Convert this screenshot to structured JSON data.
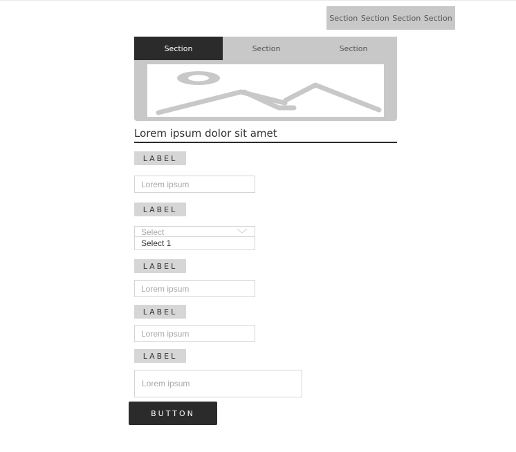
{
  "top_nav": {
    "items": [
      "Section",
      "Section",
      "Section",
      "Section"
    ]
  },
  "tabs": [
    {
      "label": "Section",
      "active": true
    },
    {
      "label": "Section",
      "active": false
    },
    {
      "label": "Section",
      "active": false
    }
  ],
  "image_placeholder": {
    "icon": "image-placeholder-icon"
  },
  "heading": "Lorem ipsum dolor sit amet",
  "form": {
    "field1": {
      "label": "LABEL",
      "placeholder": "Lorem ipsum"
    },
    "field2": {
      "label": "LABEL",
      "placeholder": "Select",
      "selected": "Select 1"
    },
    "field3": {
      "label": "LABEL",
      "placeholder": "Lorem ipsum"
    },
    "field4": {
      "label": "LABEL",
      "placeholder": "Lorem ipsum"
    },
    "field5": {
      "label": "LABEL",
      "placeholder": "Lorem ipsum"
    }
  },
  "button_label": "BUTTON",
  "colors": {
    "dark": "#2b2b2b",
    "gray": "#c8c8c8",
    "label_bg": "#d6d6d6",
    "border": "#d4d4d4",
    "placeholder": "#a8a8a8"
  }
}
